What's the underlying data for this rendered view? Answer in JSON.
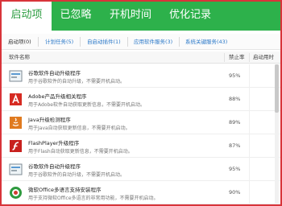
{
  "main_tabs": [
    {
      "label": "启动项"
    },
    {
      "label": "已忽略"
    },
    {
      "label": "开机时间"
    },
    {
      "label": "优化记录"
    }
  ],
  "sub_tabs": [
    {
      "label": "启动项(0)"
    },
    {
      "label": "计划任务(5)"
    },
    {
      "label": "自启动插件(1)"
    },
    {
      "label": "应用软件服务(3)"
    },
    {
      "label": "系统关键服务(43)"
    }
  ],
  "table": {
    "headers": {
      "name": "软件名称",
      "disable_rate": "禁止率",
      "boot_time": "启动用时"
    },
    "rows": [
      {
        "name": "谷歌软件自动升级程序",
        "desc": "用于谷歌软件的自动升级，不需要开机启动。",
        "pct": "95%",
        "icon": "update-icon"
      },
      {
        "name": "Adobe产品升级相关程序",
        "desc": "用于Adobe软件自动获取更新信息，不需要开机启动。",
        "pct": "88%",
        "icon": "adobe-icon"
      },
      {
        "name": "Java升级检测程序",
        "desc": "用于Java自动获取更新信息，不需要开机启动。",
        "pct": "89%",
        "icon": "java-icon"
      },
      {
        "name": "FlashPlayer升级程序",
        "desc": "用于Flash自动获取更新信息，不需要开机启动。",
        "pct": "87%",
        "icon": "flash-icon"
      },
      {
        "name": "谷歌软件自动升级程序",
        "desc": "用于谷歌软件的自动升级，不需要开机启动。",
        "pct": "95%",
        "icon": "update-icon"
      },
      {
        "name": "微软Office多语言支持安装程序",
        "desc": "用于支持微软Office多语言的非常用功能，不需要开机启动。",
        "pct": "90%",
        "icon": "office-icon"
      }
    ]
  },
  "colors": {
    "accent_green": "#2db14b",
    "frame_red": "#d8343a",
    "link_blue": "#2a78c8"
  }
}
